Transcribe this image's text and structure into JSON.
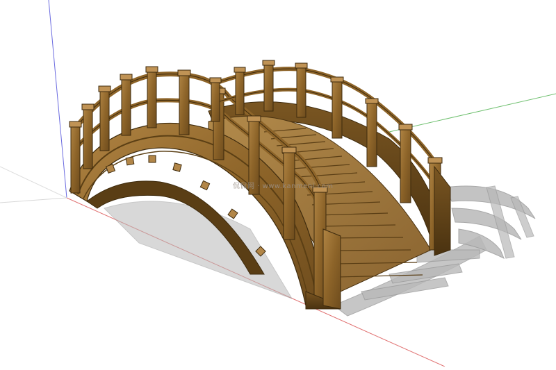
{
  "scene": {
    "subject": "wooden-arch-bridge",
    "colors": {
      "background": "#ffffff",
      "wood_light": "#a97b3a",
      "wood_mid": "#8a6128",
      "wood_dark": "#4e3512",
      "shadow": "#b8b8b8",
      "axis_red": "#e06060",
      "axis_green": "#5fb85f",
      "axis_blue": "#5a5ad6"
    }
  },
  "watermark": {
    "text": "侃侃网 · www.kanmeni.com"
  }
}
